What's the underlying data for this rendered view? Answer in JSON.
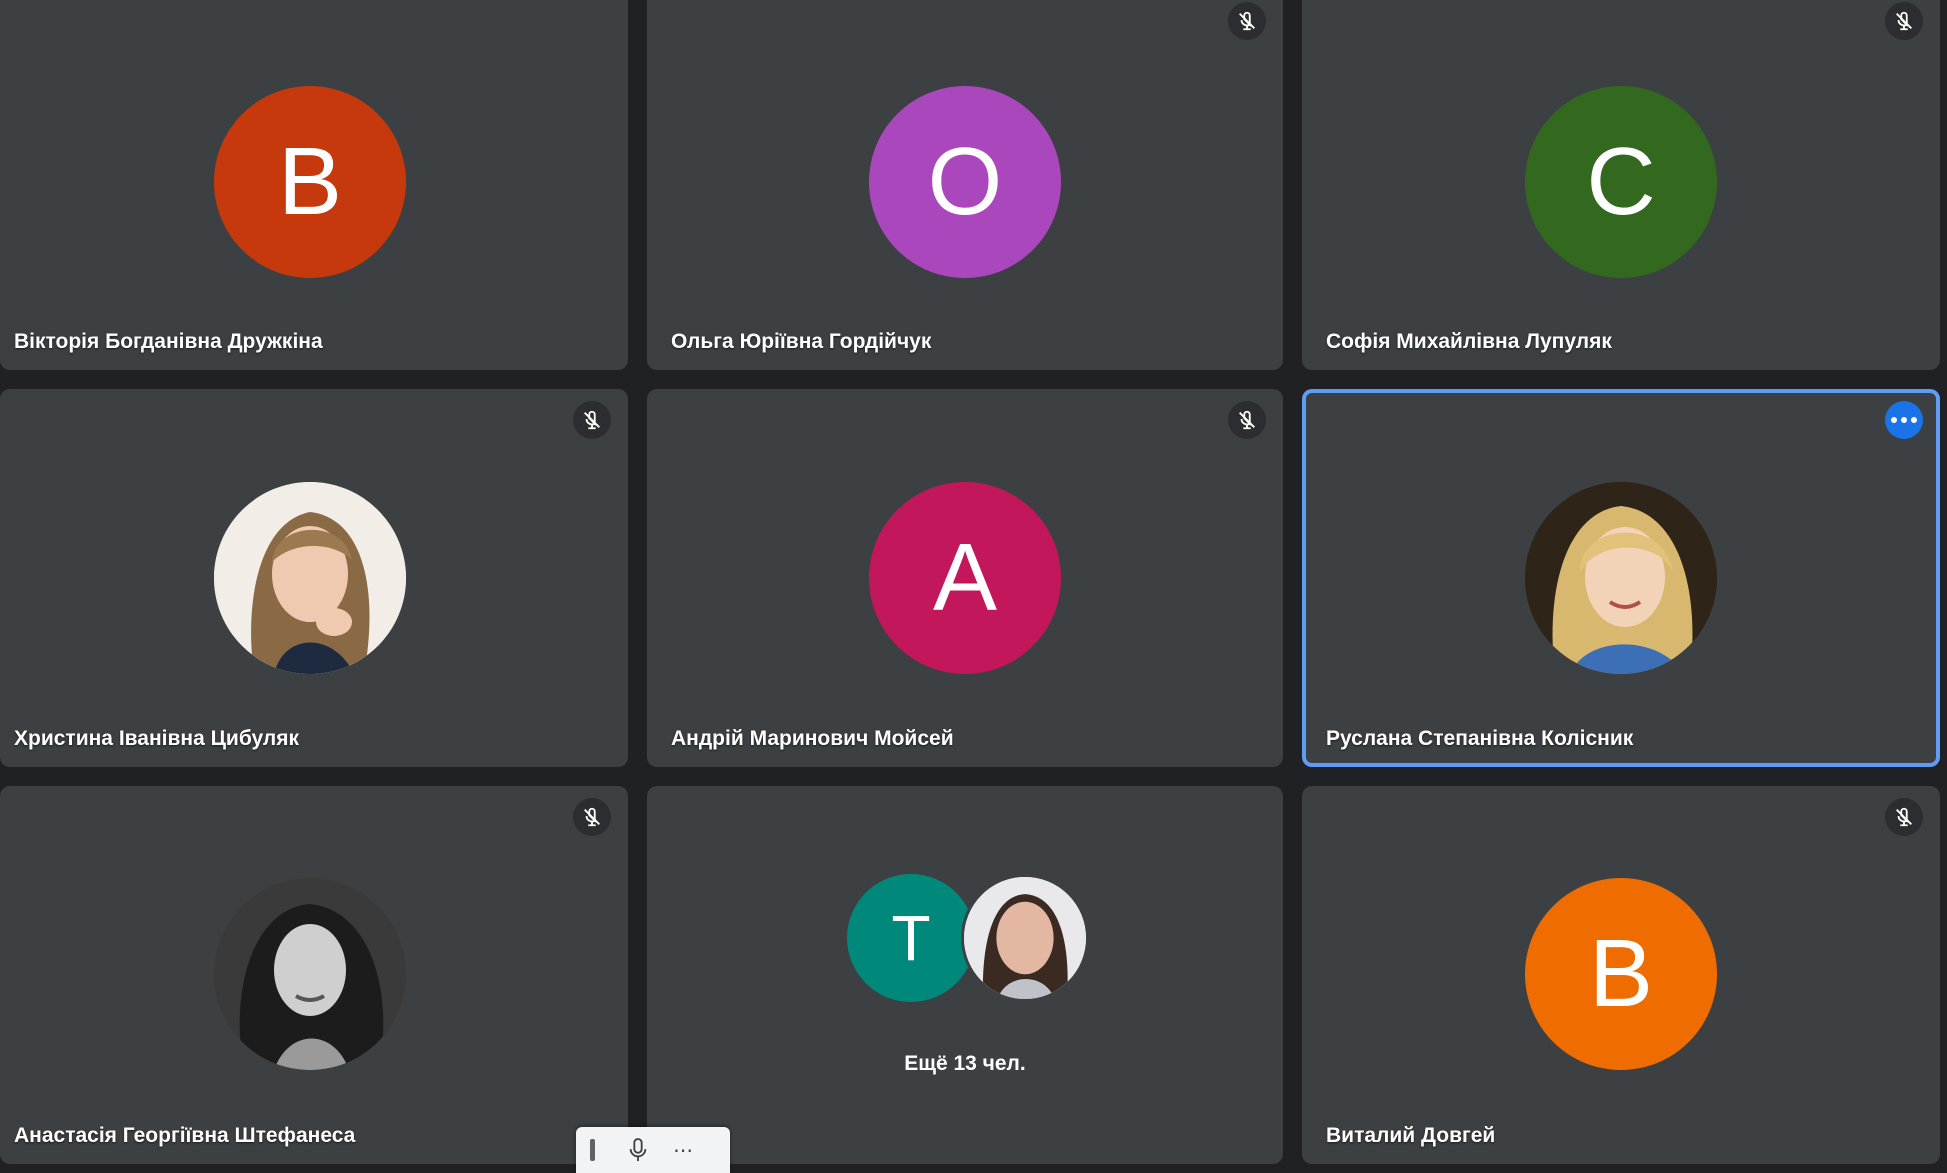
{
  "participants": [
    {
      "name": "Вікторія Богданівна Дружкіна",
      "initial": "В",
      "color": "#c5390c",
      "muted": false
    },
    {
      "name": "Ольга Юріївна Гордійчук",
      "initial": "О",
      "color": "#ab47bc",
      "muted": true
    },
    {
      "name": "Софія Михайлівна Лупуляк",
      "initial": "С",
      "color": "#33691e",
      "muted": true
    },
    {
      "name": "Христина Іванівна Цибуляк",
      "initial": "",
      "color": "#d9c2b0",
      "muted": true,
      "photo": true
    },
    {
      "name": "Андрій Маринович Мойсей",
      "initial": "А",
      "color": "#c2185b",
      "muted": true
    },
    {
      "name": "Руслана Степанівна Колісник",
      "initial": "",
      "color": "#d4b064",
      "muted": false,
      "photo": true,
      "active": true
    },
    {
      "name": "Анастасія Георгіївна Штефанеса",
      "initial": "",
      "color": "#555555",
      "muted": true,
      "photo": true
    },
    {
      "name": "Виталий Довгей",
      "initial": "В",
      "color": "#ef6c00",
      "muted": true
    }
  ],
  "overflow": {
    "label": "Ещё 13 чел.",
    "avatar1_initial": "Т",
    "avatar1_color": "#00897b"
  },
  "icons": {
    "mute": "mic-off-icon",
    "more": "more-options-icon",
    "mic": "mic-icon"
  },
  "self_bar": {
    "more_label": "⋯"
  }
}
